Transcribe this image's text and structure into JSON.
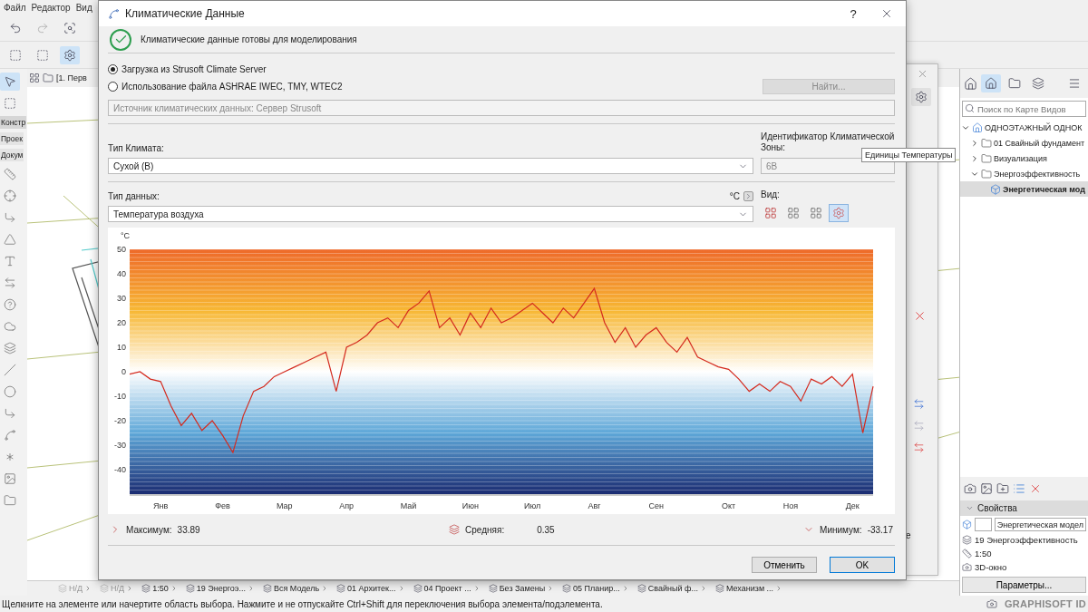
{
  "menu": [
    "Файл",
    "Редактор",
    "Вид"
  ],
  "view_tab": {
    "label": "[1. Перв"
  },
  "palette_tabs": [
    {
      "label": "Констр",
      "selected": true
    },
    {
      "label": "Проек",
      "selected": false
    },
    {
      "label": "Докум",
      "selected": false
    }
  ],
  "navigator": {
    "search": {
      "placeholder": "Поиск по Карте Видов"
    },
    "tree": [
      {
        "label": "ОДНОЭТАЖНЫЙ ОДНОК",
        "expanded": true,
        "selected": false,
        "kind": "root",
        "children": [
          {
            "label": "01 Свайный фундамент",
            "expanded": false,
            "selected": false,
            "kind": "folder"
          },
          {
            "label": "Визуализация",
            "expanded": false,
            "selected": false,
            "kind": "folder"
          },
          {
            "label": "Энергоэффективность",
            "expanded": true,
            "selected": false,
            "kind": "folder",
            "children": [
              {
                "label": "Энергетическая мод",
                "selected": true,
                "kind": "view"
              }
            ]
          }
        ]
      }
    ]
  },
  "properties": {
    "title": "Свойства",
    "expanded": true,
    "name_value": "Энергетическая модел",
    "rows": [
      "19 Энергоэффективность",
      "1:50",
      "3D-окно"
    ],
    "button": "Параметры..."
  },
  "brand": "GRAPHISOFT ID",
  "bottom_bar": [
    {
      "label": "Н/Д",
      "disabled": true
    },
    {
      "label": "Н/Д",
      "disabled": true
    },
    {
      "label": "1:50",
      "disabled": false
    },
    {
      "label": "19 Энергоэ...",
      "disabled": false
    },
    {
      "label": "Вся Модель",
      "disabled": false
    },
    {
      "label": "01 Архитек...",
      "disabled": false
    },
    {
      "label": "04 Проект ...",
      "disabled": false
    },
    {
      "label": "Без Замены",
      "disabled": false
    },
    {
      "label": "05 Планир...",
      "disabled": false
    },
    {
      "label": "Свайный ф...",
      "disabled": false
    },
    {
      "label": "Механизм ...",
      "disabled": false
    }
  ],
  "status_bar": "Щелкните на элементе или начертите область выбора. Нажмите и не отпускайте Ctrl+Shift для переключения выбора элемента/подэлемента.",
  "back_palette": {
    "dropdown_text": "e"
  },
  "tooltip": "Единицы Температуры",
  "dialog": {
    "title": "Климатические Данные",
    "help": "?",
    "status": "Климатические данные готовы для моделирования",
    "sources": [
      {
        "label": "Загрузка из Strusoft Climate Server",
        "selected": true
      },
      {
        "label": "Использование файла ASHRAE IWEC, TMY, WTEC2",
        "selected": false
      }
    ],
    "find_button": {
      "label": "Найти...",
      "disabled": true
    },
    "source_field": "Источник климатических данных: Сервер Strusoft",
    "climate_label": "Тип Климата:",
    "climate_value": "Сухой (B)",
    "zone_label": "Идентификатор Климатической Зоны:",
    "zone_value": "6B",
    "data_label": "Тип данных:",
    "data_value": "Температура воздуха",
    "units": "°C",
    "view_label": "Вид:",
    "views": [
      {
        "selected": false
      },
      {
        "selected": false
      },
      {
        "selected": false
      },
      {
        "selected": true
      }
    ],
    "chart_data": {
      "type": "line",
      "ylabel": "°C",
      "grid": true,
      "ylim": [
        -50,
        50
      ],
      "yticks": [
        -40,
        -30,
        -20,
        -10,
        0,
        10,
        20,
        30,
        40,
        50
      ],
      "categories": [
        null,
        null,
        null,
        "Янв",
        null,
        null,
        null,
        null,
        null,
        "Фев",
        null,
        null,
        null,
        null,
        null,
        "Мар",
        null,
        null,
        null,
        null,
        null,
        "Апр",
        null,
        null,
        null,
        null,
        null,
        "Май",
        null,
        null,
        null,
        null,
        null,
        "Июн",
        null,
        null,
        null,
        null,
        null,
        "Июл",
        null,
        null,
        null,
        null,
        null,
        "Авг",
        null,
        null,
        null,
        null,
        null,
        "Сен",
        null,
        null,
        null,
        null,
        null,
        null,
        "Окт",
        null,
        null,
        null,
        null,
        null,
        "Ноя",
        null,
        null,
        null,
        null,
        null,
        "Дек",
        null,
        null
      ],
      "series": [
        {
          "color": "#d42a1e",
          "values": [
            -1,
            0,
            -3,
            -4,
            -14,
            -22,
            -17,
            -24,
            -20,
            -26,
            -33,
            -18,
            -8,
            -6,
            -2,
            0,
            2,
            4,
            6,
            8,
            -8,
            10,
            12,
            15,
            20,
            22,
            18,
            25,
            28,
            33,
            18,
            22,
            15,
            24,
            18,
            26,
            20,
            22,
            25,
            28,
            24,
            20,
            26,
            22,
            28,
            34,
            20,
            12,
            18,
            10,
            15,
            18,
            12,
            8,
            14,
            6,
            4,
            2,
            1,
            -3,
            -8,
            -5,
            -8,
            -4,
            -6,
            -12,
            -3,
            -5,
            -2,
            -6,
            -1,
            -25,
            -6
          ]
        }
      ]
    },
    "stats": [
      {
        "label": "Максимум:",
        "value": "33.89"
      },
      {
        "label": "Средняя:",
        "value": "0.35"
      },
      {
        "label": "Минимум:",
        "value": "-33.17"
      }
    ],
    "buttons": [
      "Отменить",
      "OK"
    ]
  }
}
